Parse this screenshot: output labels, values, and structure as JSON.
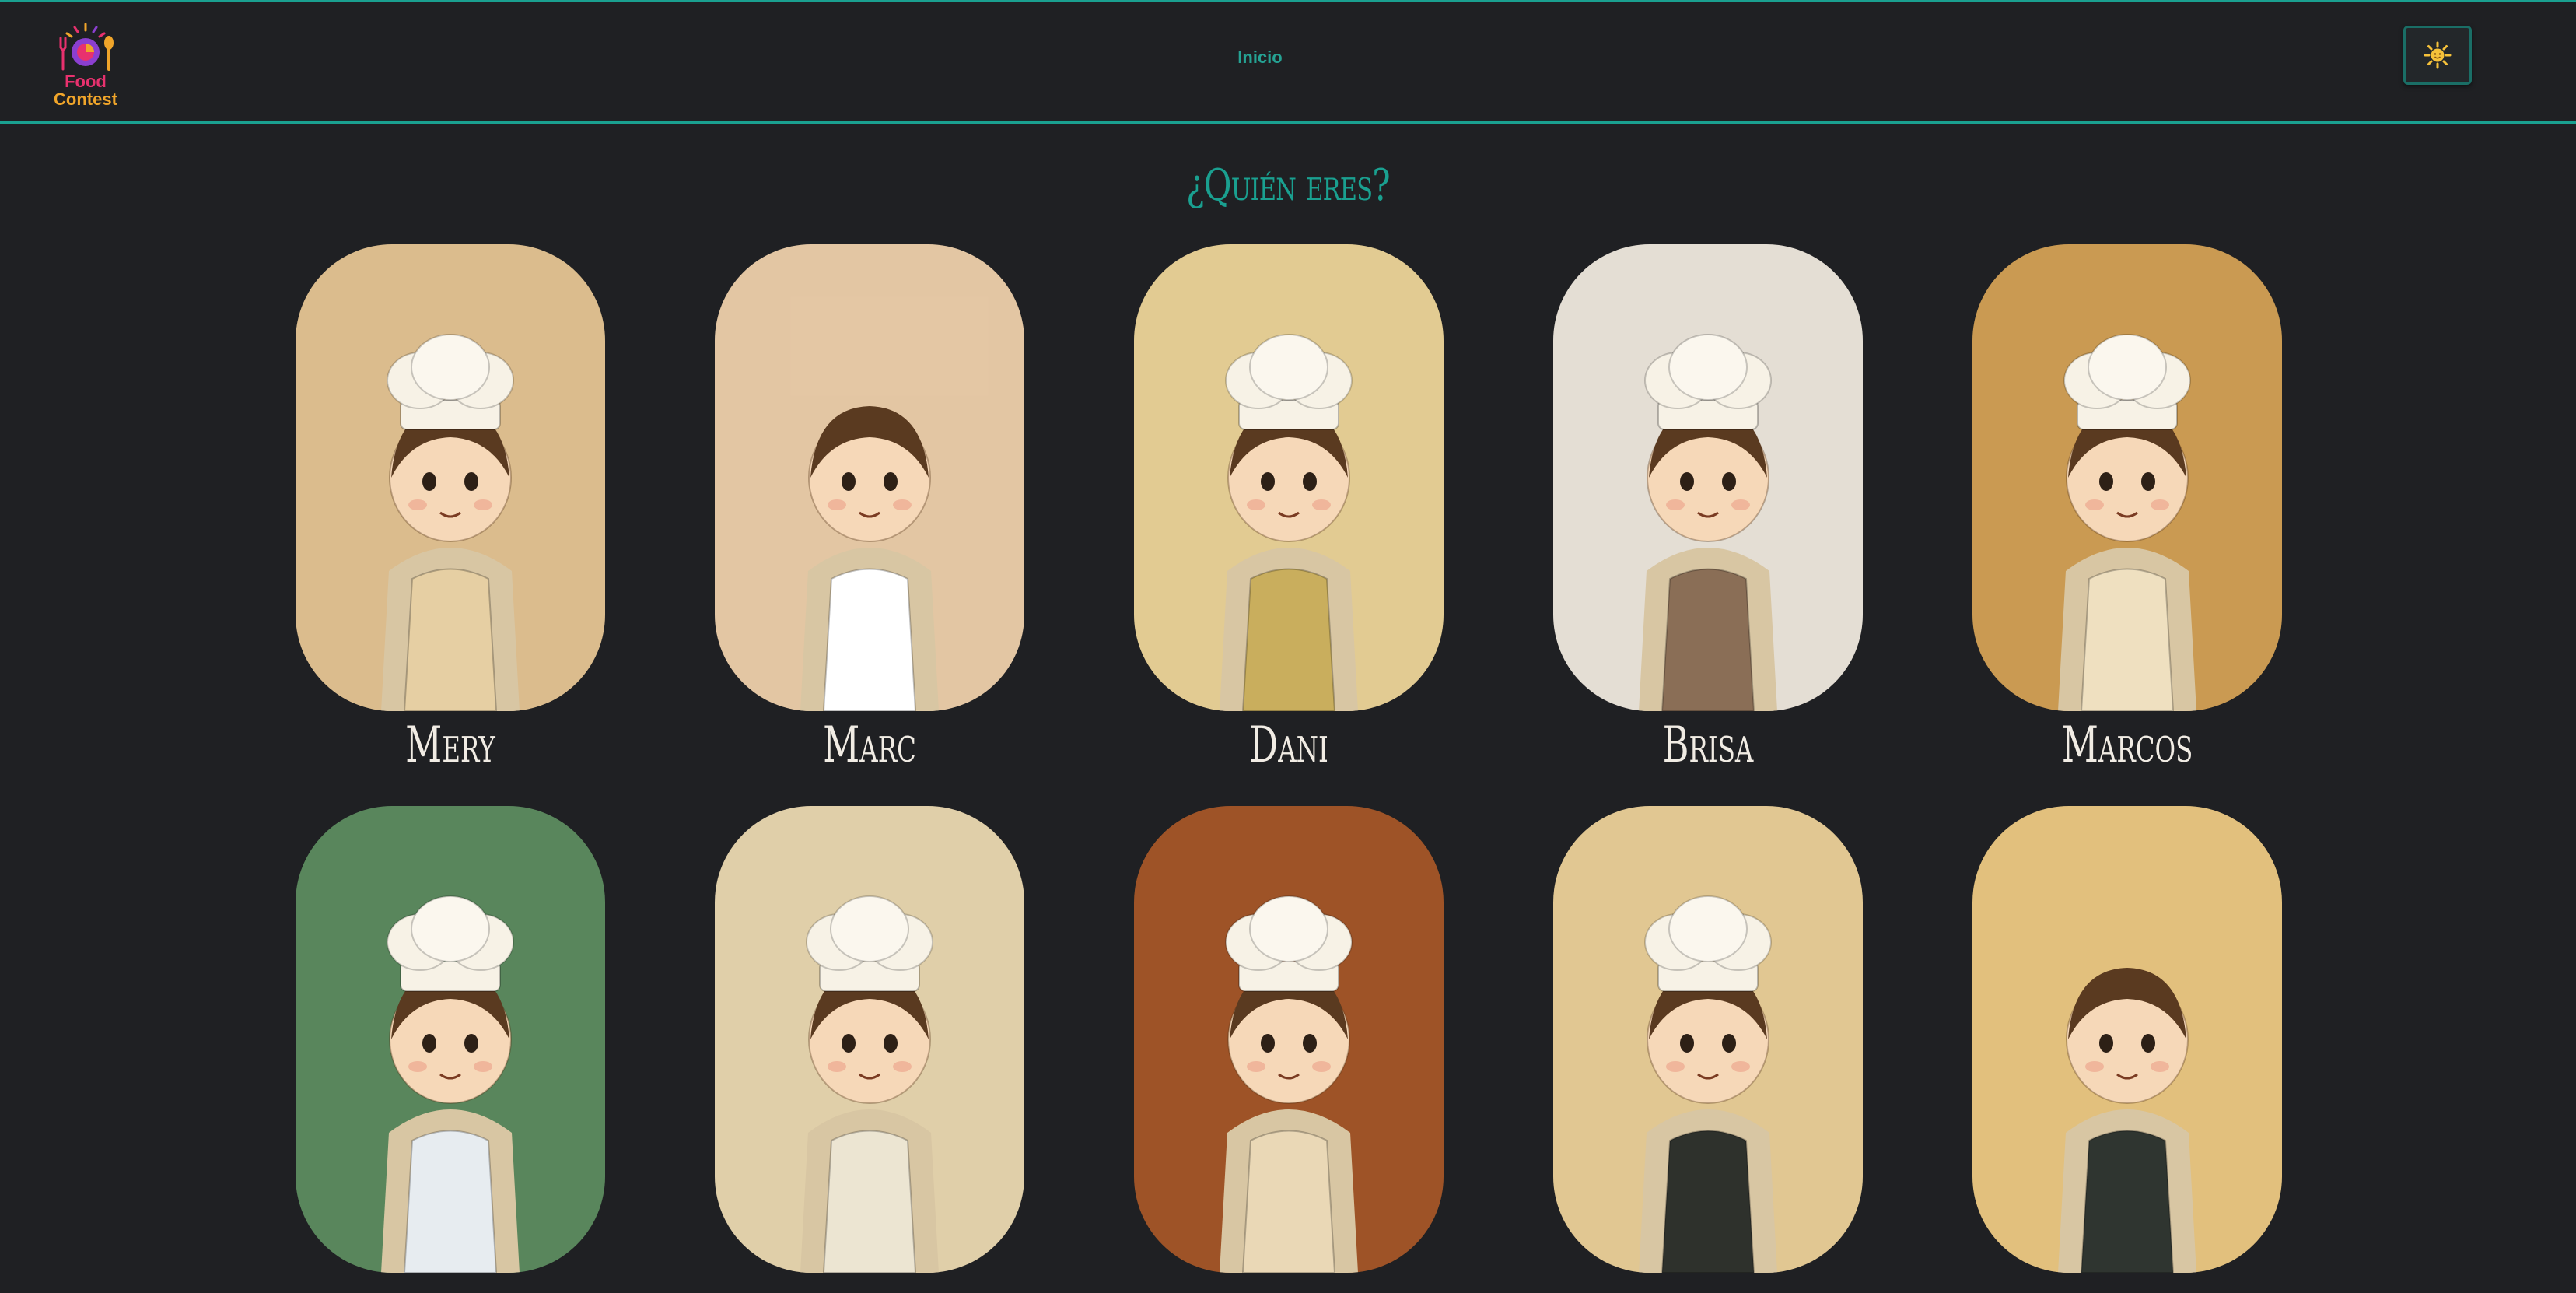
{
  "header": {
    "logo": {
      "line1": "Food",
      "line2": "Contest",
      "icon": "fork-spoon-plate-icon"
    },
    "nav": {
      "home_label": "Inicio"
    },
    "theme_toggle": {
      "icon": "sun-icon"
    }
  },
  "main": {
    "title": "¿Quién eres?",
    "profiles": [
      {
        "name": "Mery",
        "bg": "#e9c896",
        "apron": "#e6cfa3",
        "hat": true
      },
      {
        "name": "Marc",
        "bg": "#f2d3ae",
        "apron": "#ffffff",
        "hat": false
      },
      {
        "name": "Dani",
        "bg": "#f1d89c",
        "apron": "#c9ae5d",
        "hat": true
      },
      {
        "name": "Brisa",
        "bg": "#f3ece2",
        "apron": "#8a6e56",
        "hat": true
      },
      {
        "name": "Marcos",
        "bg": "#d7a458",
        "apron": "#efe0c0",
        "hat": true
      },
      {
        "name": "",
        "bg": "#5f8f62",
        "apron": "#e7ecf0",
        "hat": true
      },
      {
        "name": "",
        "bg": "#efdcb4",
        "apron": "#ece5d2",
        "hat": true
      },
      {
        "name": "",
        "bg": "#a8592a",
        "apron": "#ead8b6",
        "hat": true
      },
      {
        "name": "",
        "bg": "#f0d49c",
        "apron": "#2e312c",
        "hat": true
      },
      {
        "name": "",
        "bg": "#f1cd85",
        "apron": "#2f3530",
        "hat": false
      }
    ]
  },
  "colors": {
    "background": "#1f2023",
    "accent": "#1aa090",
    "name_text": "#f1ece4"
  }
}
